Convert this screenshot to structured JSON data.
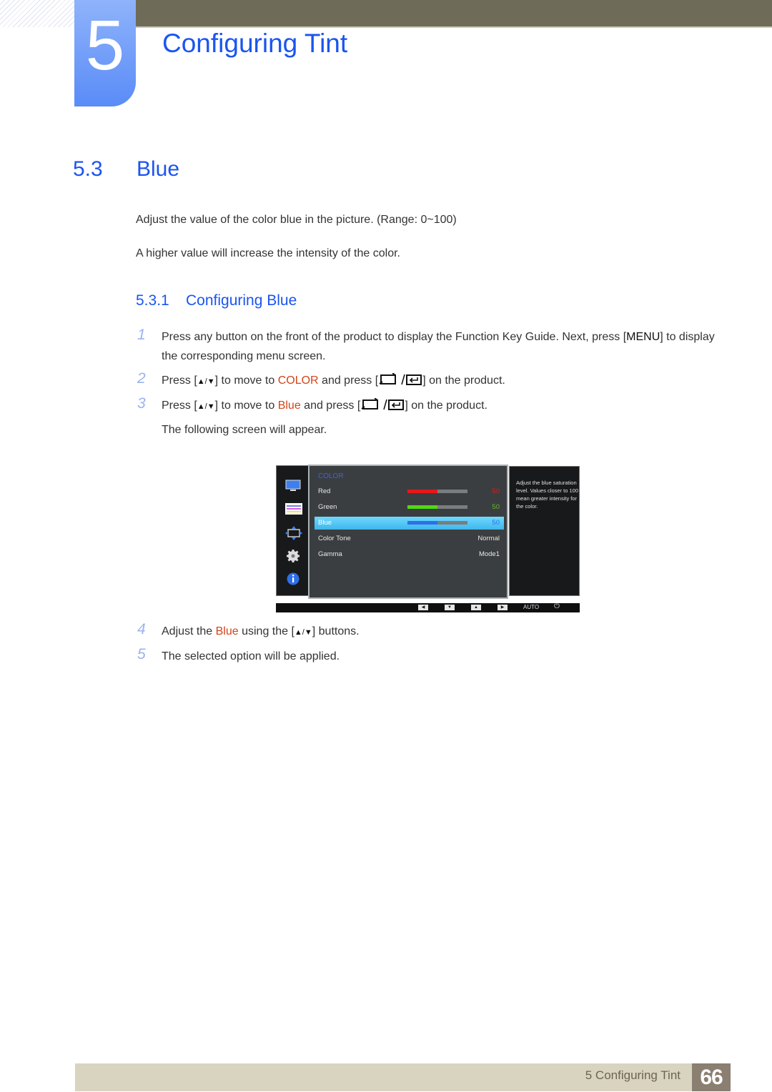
{
  "header": {
    "chapter_number": "5",
    "chapter_title": "Configuring Tint"
  },
  "section": {
    "number": "5.3",
    "title": "Blue",
    "paragraphs": [
      "Adjust the value of the color blue in the picture. (Range: 0~100)",
      "A higher value will increase the intensity of the color."
    ]
  },
  "subsection": {
    "number": "5.3.1",
    "title": "Configuring Blue"
  },
  "steps": [
    {
      "num": "1",
      "pre": "Press any button on the front of the product to display the Function Key Guide. Next, press [",
      "key": "MENU",
      "post": "] to display the corresponding menu screen."
    },
    {
      "num": "2",
      "pre": "Press [",
      "arrows": "▲/▼",
      "mid": "] to move to ",
      "highlight": "COLOR",
      "mid2": " and press [",
      "post": "] on the product."
    },
    {
      "num": "3",
      "pre": "Press [",
      "arrows": "▲/▼",
      "mid": "] to move to ",
      "highlight": "Blue",
      "mid2": " and press [",
      "post": "] on the product.",
      "note": "The following screen will appear."
    },
    {
      "num": "4",
      "pre": "Adjust the ",
      "highlight": "Blue",
      "mid": " using the [",
      "arrows": "▲/▼",
      "post": "] buttons."
    },
    {
      "num": "5",
      "text": "The selected option will be applied."
    }
  ],
  "osd": {
    "side_icons": [
      "picture-icon",
      "color-icon",
      "size-position-icon",
      "setup-icon",
      "information-icon"
    ],
    "heading": "COLOR",
    "rows": [
      {
        "label": "Red",
        "value": "50",
        "level_percent": 50,
        "color": "#e8171a",
        "value_color": "#c92222",
        "selected": false
      },
      {
        "label": "Green",
        "value": "50",
        "level_percent": 50,
        "color": "#52d812",
        "value_color": "#63b82b",
        "selected": false
      },
      {
        "label": "Blue",
        "value": "50",
        "level_percent": 50,
        "color": "#2f6fe6",
        "value_color": "#2f6fe6",
        "selected": true
      },
      {
        "label": "Color Tone",
        "value": "Normal",
        "selected": false
      },
      {
        "label": "Gamma",
        "value": "Mode1",
        "selected": false
      }
    ],
    "help_text": "Adjust the blue saturation level. Values closer to 100 mean greater intensity for the color.",
    "bottom_buttons": [
      "◀",
      "▼",
      "▲",
      "▶"
    ],
    "auto_label": "AUTO",
    "power_glyph": "⏻"
  },
  "footer": {
    "chapter_label": "5 Configuring Tint",
    "page_number": "66"
  }
}
